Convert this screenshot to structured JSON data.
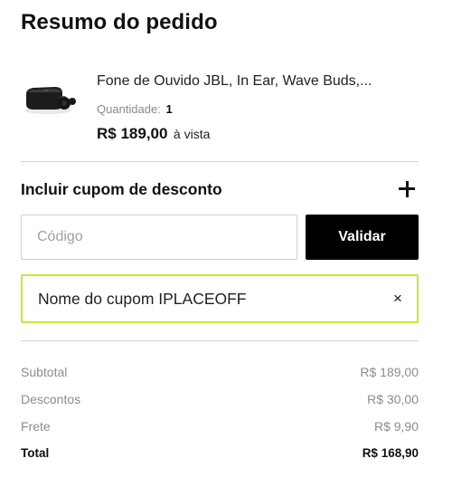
{
  "title": "Resumo do pedido",
  "product": {
    "name": "Fone de Ouvido JBL, In Ear, Wave Buds,...",
    "quantity_label": "Quantidade:",
    "quantity": "1",
    "price": "R$ 189,00",
    "price_note": "à vista",
    "image_icon": "earbuds-product-image"
  },
  "coupon": {
    "heading": "Incluir cupom de desconto",
    "toggle_icon": "plus-icon",
    "input_value": "",
    "input_placeholder": "Código",
    "validate_label": "Validar",
    "applied_text": "Nome do cupom IPLACEOFF",
    "remove_icon": "×"
  },
  "summary": {
    "rows": [
      {
        "label": "Subtotal",
        "value": "R$ 189,00"
      },
      {
        "label": "Descontos",
        "value": "R$ 30,00"
      },
      {
        "label": "Frete",
        "value": "R$ 9,90"
      }
    ],
    "total_label": "Total",
    "total_value": "R$ 168,90"
  },
  "colors": {
    "accent": "#d2e23a",
    "button": "#000000",
    "muted_text": "#8c8c8c",
    "divider": "#d4d4d4"
  }
}
